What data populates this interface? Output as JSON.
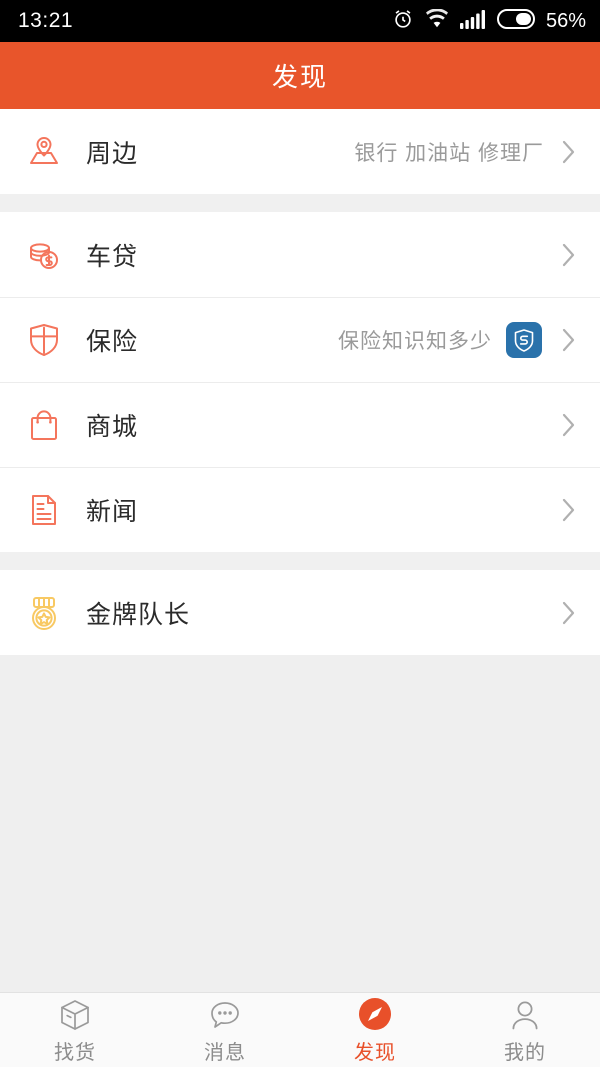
{
  "status_bar": {
    "time": "13:21",
    "battery_percent": "56%",
    "battery_level": 56,
    "icons": [
      "alarm-icon",
      "wifi-icon",
      "signal-icon",
      "battery-icon"
    ]
  },
  "header": {
    "title": "发现",
    "background_color": "#e8552b"
  },
  "colors": {
    "accent": "#e8552b",
    "icon_coral": "#f4755c",
    "icon_gold": "#f8c963",
    "badge_blue": "#2a72ab",
    "subtext_gray": "#9a9a9a",
    "page_bg": "#efefef"
  },
  "list": {
    "groups": [
      {
        "rows": [
          {
            "label": "周边",
            "sub": "银行 加油站 修理厂",
            "icon": "map-pin-icon",
            "badge": null
          }
        ]
      },
      {
        "rows": [
          {
            "label": "车贷",
            "sub": "",
            "icon": "coins-icon",
            "badge": null
          },
          {
            "label": "保险",
            "sub": "保险知识知多少",
            "icon": "shield-cross-icon",
            "badge": "shield-s-badge-icon"
          },
          {
            "label": "商城",
            "sub": "",
            "icon": "shopping-bag-icon",
            "badge": null
          },
          {
            "label": "新闻",
            "sub": "",
            "icon": "document-icon",
            "badge": null
          }
        ]
      },
      {
        "rows": [
          {
            "label": "金牌队长",
            "sub": "",
            "icon": "medal-icon",
            "badge": null
          }
        ]
      }
    ]
  },
  "tabbar": {
    "tabs": [
      {
        "label": "找货",
        "icon": "box-icon",
        "active": false
      },
      {
        "label": "消息",
        "icon": "chat-bubble-icon",
        "active": false
      },
      {
        "label": "发现",
        "icon": "compass-icon",
        "active": true
      },
      {
        "label": "我的",
        "icon": "person-icon",
        "active": false
      }
    ]
  }
}
